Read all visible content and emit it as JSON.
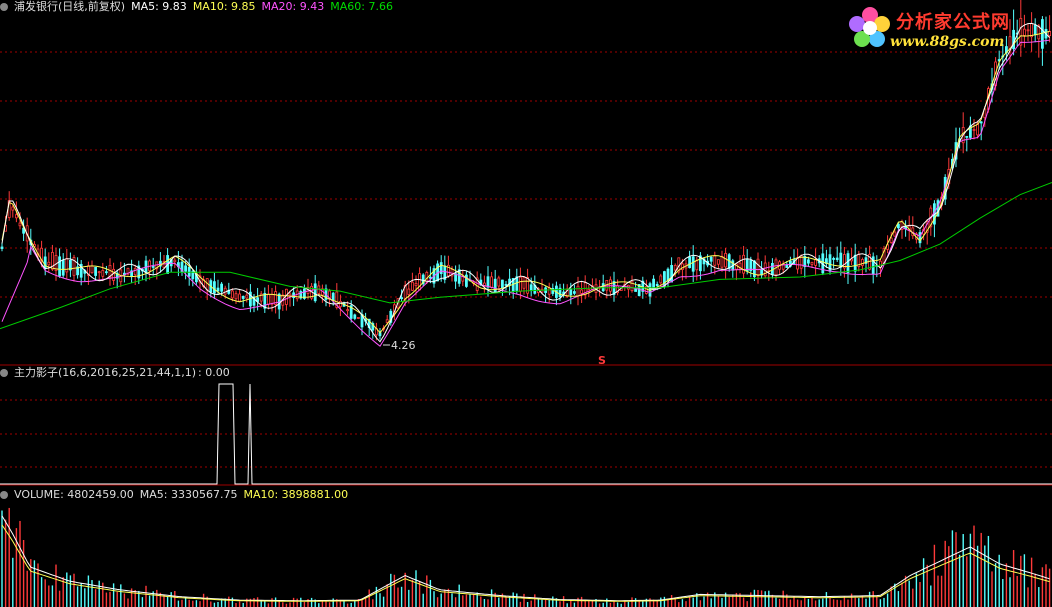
{
  "price_panel": {
    "title": "浦发银行(日线,前复权)",
    "ma5": "MA5: 9.83",
    "ma10": "MA10: 9.85",
    "ma20": "MA20: 9.43",
    "ma60": "MA60: 7.66",
    "low_label": "4.26",
    "marker_label": "S"
  },
  "indicator_panel": {
    "title": "主力影子(16,6,2016,25,21,44,1,1)",
    "value": ": 0.00"
  },
  "volume_panel": {
    "volume": "VOLUME: 4802459.00",
    "ma5": "MA5: 3330567.75",
    "ma10": "MA10: 3898881.00"
  },
  "logo": {
    "title": "分析家公式网",
    "url": "www.88gs.com"
  },
  "colors": {
    "up": "#ff3a3a",
    "down": "#54ffff",
    "ma5": "#ffffff",
    "ma10": "#ffff54",
    "ma20": "#ff54ff",
    "ma60": "#00cc00",
    "grid": "#a00000"
  },
  "chart_data": {
    "type": "candlestick",
    "price_range": [
      3.8,
      11.2
    ],
    "price_low_marked": 4.26,
    "ma_last": {
      "ma5": 9.83,
      "ma10": 9.85,
      "ma20": 9.43,
      "ma60": 7.66
    },
    "price_path": [
      [
        0,
        6.1
      ],
      [
        10,
        7.2
      ],
      [
        25,
        6.6
      ],
      [
        45,
        6.0
      ],
      [
        80,
        5.8
      ],
      [
        120,
        5.7
      ],
      [
        150,
        5.85
      ],
      [
        175,
        6.0
      ],
      [
        200,
        5.6
      ],
      [
        240,
        5.2
      ],
      [
        280,
        5.15
      ],
      [
        320,
        5.4
      ],
      [
        345,
        5.0
      ],
      [
        380,
        4.45
      ],
      [
        405,
        5.3
      ],
      [
        440,
        5.8
      ],
      [
        480,
        5.5
      ],
      [
        520,
        5.5
      ],
      [
        560,
        5.3
      ],
      [
        600,
        5.45
      ],
      [
        650,
        5.4
      ],
      [
        680,
        5.9
      ],
      [
        720,
        6.0
      ],
      [
        760,
        5.8
      ],
      [
        800,
        5.95
      ],
      [
        840,
        6.0
      ],
      [
        870,
        5.95
      ],
      [
        880,
        5.9
      ],
      [
        900,
        6.8
      ],
      [
        920,
        6.5
      ],
      [
        940,
        7.2
      ],
      [
        960,
        8.6
      ],
      [
        980,
        8.8
      ],
      [
        1000,
        10.3
      ],
      [
        1020,
        10.9
      ],
      [
        1052,
        10.8
      ]
    ],
    "ma60_path": [
      [
        0,
        4.55
      ],
      [
        60,
        5.0
      ],
      [
        110,
        5.4
      ],
      [
        170,
        5.75
      ],
      [
        230,
        5.75
      ],
      [
        290,
        5.45
      ],
      [
        340,
        5.35
      ],
      [
        390,
        5.1
      ],
      [
        440,
        5.22
      ],
      [
        520,
        5.35
      ],
      [
        600,
        5.42
      ],
      [
        660,
        5.42
      ],
      [
        720,
        5.6
      ],
      [
        800,
        5.65
      ],
      [
        860,
        5.8
      ],
      [
        900,
        6.0
      ],
      [
        940,
        6.35
      ],
      [
        980,
        6.9
      ],
      [
        1020,
        7.4
      ],
      [
        1052,
        7.66
      ]
    ],
    "signal_pulses": [
      {
        "from": 217,
        "to": 235,
        "value": 1
      },
      {
        "from": 248,
        "to": 252,
        "value": 1
      }
    ],
    "volume_range": [
      0,
      18000000
    ],
    "volume_path": [
      [
        0,
        16500000
      ],
      [
        12,
        13000000
      ],
      [
        30,
        7000000
      ],
      [
        70,
        4500000
      ],
      [
        120,
        3000000
      ],
      [
        180,
        1800000
      ],
      [
        240,
        1200000
      ],
      [
        300,
        1100000
      ],
      [
        360,
        1200000
      ],
      [
        405,
        5500000
      ],
      [
        440,
        3000000
      ],
      [
        500,
        2000000
      ],
      [
        560,
        1300000
      ],
      [
        620,
        1100000
      ],
      [
        660,
        1200000
      ],
      [
        700,
        2200000
      ],
      [
        760,
        2000000
      ],
      [
        820,
        1800000
      ],
      [
        880,
        2000000
      ],
      [
        910,
        5500000
      ],
      [
        940,
        8000000
      ],
      [
        970,
        10500000
      ],
      [
        1000,
        7500000
      ],
      [
        1030,
        6000000
      ],
      [
        1052,
        4800000
      ]
    ]
  }
}
